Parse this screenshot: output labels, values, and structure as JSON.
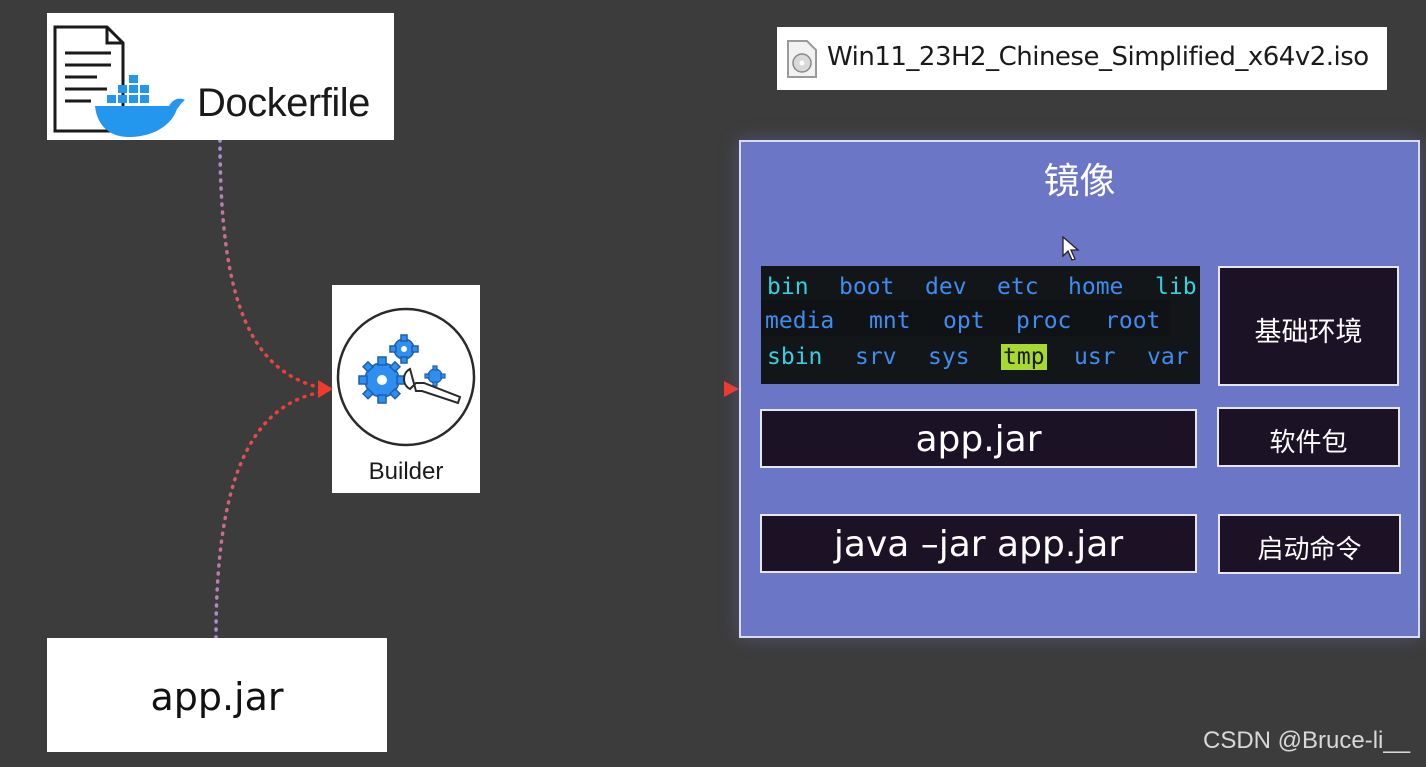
{
  "dockerfile": {
    "label": "Dockerfile",
    "brand_color": "#2396ed"
  },
  "iso_file": {
    "name": "Win11_23H2_Chinese_Simplified_x64v2.iso"
  },
  "builder": {
    "label": "Builder",
    "gear_color": "#2f8ff0"
  },
  "source_jar": {
    "label": "app.jar"
  },
  "image": {
    "title": "镜像",
    "panel_color": "#6b76c6",
    "filesystem": [
      [
        "bin",
        "boot",
        "dev",
        "etc",
        "home",
        "lib"
      ],
      [
        "media",
        "mnt",
        "opt",
        "proc",
        "root"
      ],
      [
        "sbin",
        "srv",
        "sys",
        "tmp",
        "usr",
        "var"
      ]
    ],
    "layers": [
      {
        "content": "app.jar",
        "role": "软件包"
      },
      {
        "content": "java –jar app.jar",
        "role": "启动命令"
      }
    ],
    "env_label": "基础环境"
  },
  "watermark": "CSDN @Bruce-li__"
}
